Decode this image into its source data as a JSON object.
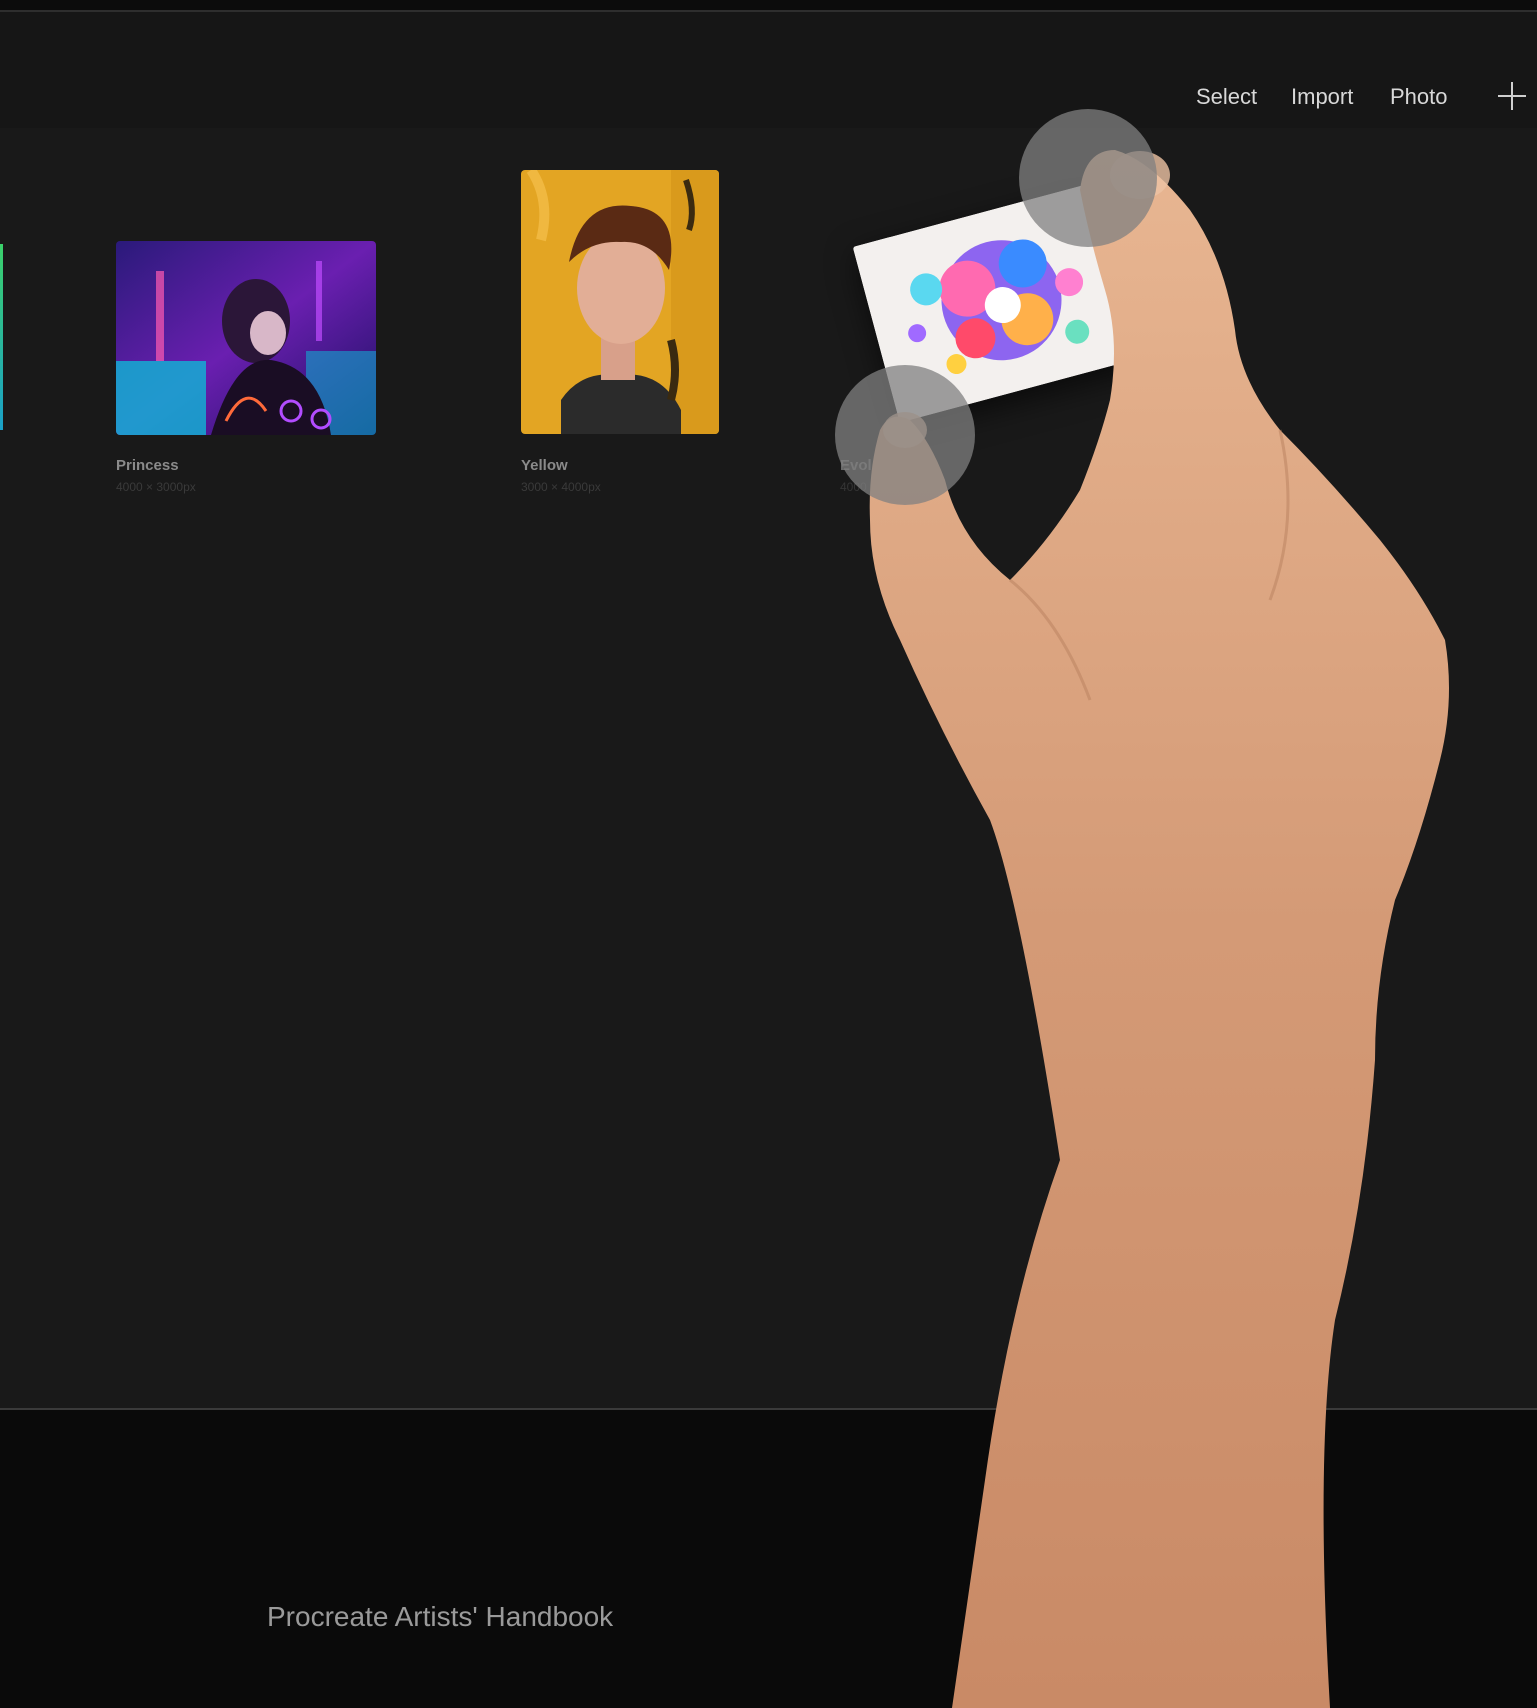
{
  "toolbar": {
    "select_label": "Select",
    "import_label": "Import",
    "photo_label": "Photo",
    "add_icon": "plus-icon"
  },
  "gallery": {
    "artworks": [
      {
        "title": "Princess",
        "dimensions": "4000 × 3000px"
      },
      {
        "title": "Yellow",
        "dimensions": "3000 × 4000px"
      },
      {
        "title": "Evol",
        "dimensions": "4000"
      }
    ]
  },
  "footer": {
    "caption": "Procreate Artists' Handbook"
  },
  "colors": {
    "screen_bg": "#191919",
    "toolbar_bg": "#161616",
    "outer_bg": "#0a0a0a",
    "touch_indicator": "#808080"
  }
}
